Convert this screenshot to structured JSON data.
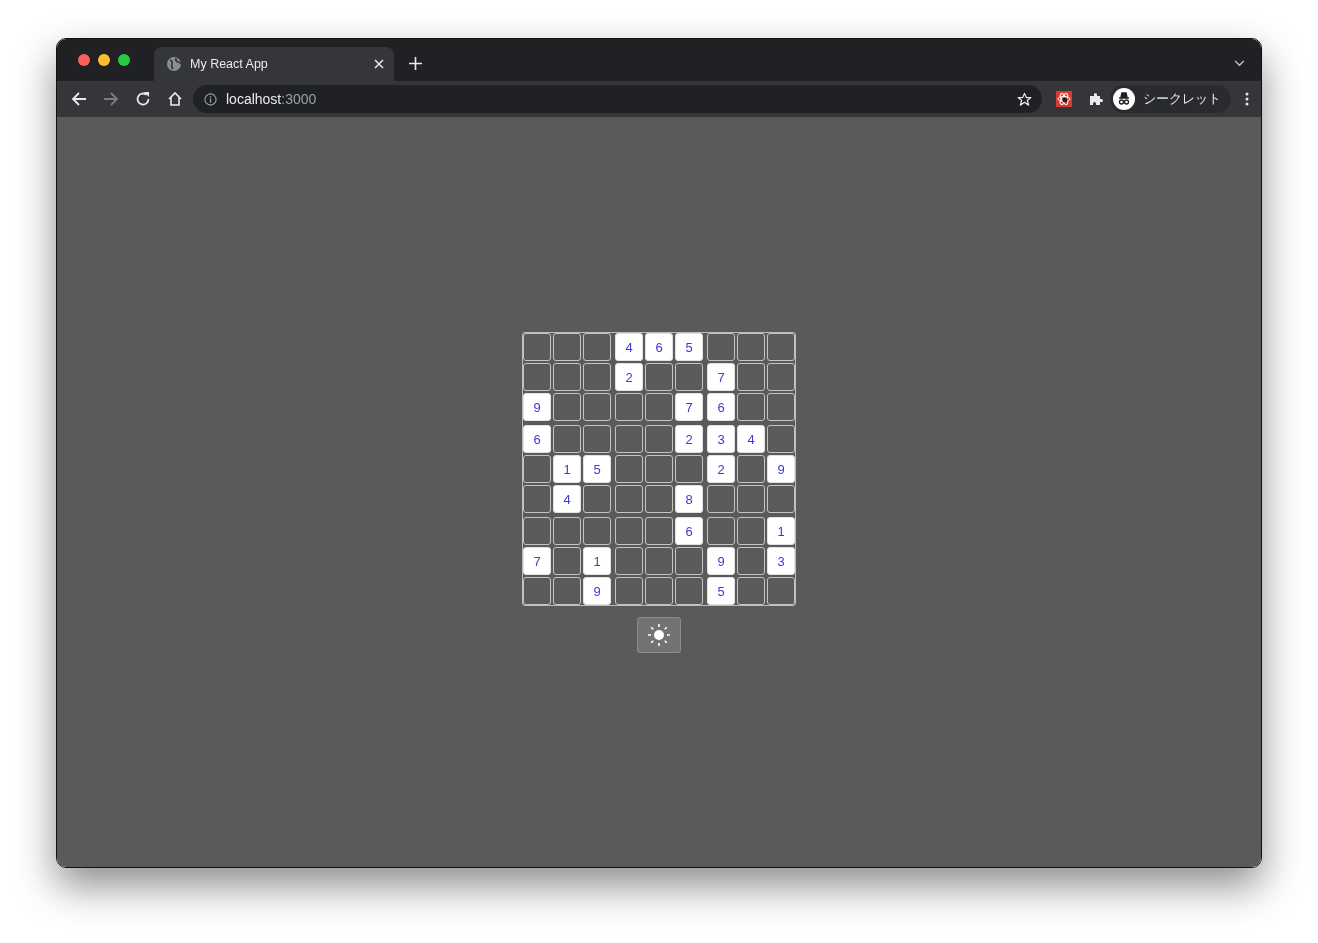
{
  "browser": {
    "tab_title": "My React App",
    "address_host": "localhost",
    "address_port": ":3000",
    "profile_label": "シークレット"
  },
  "sudoku": {
    "rows": [
      [
        null,
        null,
        null,
        "4",
        "6",
        "5",
        null,
        null,
        null
      ],
      [
        null,
        null,
        null,
        "2",
        null,
        null,
        "7",
        null,
        null
      ],
      [
        "9",
        null,
        null,
        null,
        null,
        "7",
        "6",
        null,
        null
      ],
      [
        "6",
        null,
        null,
        null,
        null,
        "2",
        "3",
        "4",
        null
      ],
      [
        null,
        "1",
        "5",
        null,
        null,
        null,
        "2",
        null,
        "9"
      ],
      [
        null,
        "4",
        null,
        null,
        null,
        "8",
        null,
        null,
        null
      ],
      [
        null,
        null,
        null,
        null,
        null,
        "6",
        null,
        null,
        "1"
      ],
      [
        "7",
        null,
        "1",
        null,
        null,
        null,
        "9",
        null,
        "3"
      ],
      [
        null,
        null,
        "9",
        null,
        null,
        null,
        "5",
        null,
        null
      ]
    ]
  }
}
